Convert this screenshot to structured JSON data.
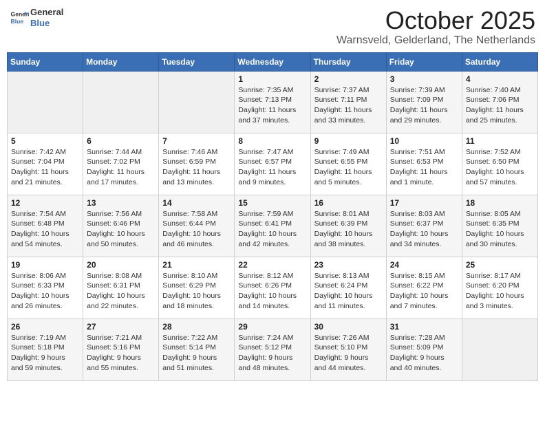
{
  "header": {
    "logo_line1": "General",
    "logo_line2": "Blue",
    "month": "October 2025",
    "location": "Warnsveld, Gelderland, The Netherlands"
  },
  "weekdays": [
    "Sunday",
    "Monday",
    "Tuesday",
    "Wednesday",
    "Thursday",
    "Friday",
    "Saturday"
  ],
  "weeks": [
    [
      {
        "day": "",
        "info": ""
      },
      {
        "day": "",
        "info": ""
      },
      {
        "day": "",
        "info": ""
      },
      {
        "day": "1",
        "info": "Sunrise: 7:35 AM\nSunset: 7:13 PM\nDaylight: 11 hours\nand 37 minutes."
      },
      {
        "day": "2",
        "info": "Sunrise: 7:37 AM\nSunset: 7:11 PM\nDaylight: 11 hours\nand 33 minutes."
      },
      {
        "day": "3",
        "info": "Sunrise: 7:39 AM\nSunset: 7:09 PM\nDaylight: 11 hours\nand 29 minutes."
      },
      {
        "day": "4",
        "info": "Sunrise: 7:40 AM\nSunset: 7:06 PM\nDaylight: 11 hours\nand 25 minutes."
      }
    ],
    [
      {
        "day": "5",
        "info": "Sunrise: 7:42 AM\nSunset: 7:04 PM\nDaylight: 11 hours\nand 21 minutes."
      },
      {
        "day": "6",
        "info": "Sunrise: 7:44 AM\nSunset: 7:02 PM\nDaylight: 11 hours\nand 17 minutes."
      },
      {
        "day": "7",
        "info": "Sunrise: 7:46 AM\nSunset: 6:59 PM\nDaylight: 11 hours\nand 13 minutes."
      },
      {
        "day": "8",
        "info": "Sunrise: 7:47 AM\nSunset: 6:57 PM\nDaylight: 11 hours\nand 9 minutes."
      },
      {
        "day": "9",
        "info": "Sunrise: 7:49 AM\nSunset: 6:55 PM\nDaylight: 11 hours\nand 5 minutes."
      },
      {
        "day": "10",
        "info": "Sunrise: 7:51 AM\nSunset: 6:53 PM\nDaylight: 11 hours\nand 1 minute."
      },
      {
        "day": "11",
        "info": "Sunrise: 7:52 AM\nSunset: 6:50 PM\nDaylight: 10 hours\nand 57 minutes."
      }
    ],
    [
      {
        "day": "12",
        "info": "Sunrise: 7:54 AM\nSunset: 6:48 PM\nDaylight: 10 hours\nand 54 minutes."
      },
      {
        "day": "13",
        "info": "Sunrise: 7:56 AM\nSunset: 6:46 PM\nDaylight: 10 hours\nand 50 minutes."
      },
      {
        "day": "14",
        "info": "Sunrise: 7:58 AM\nSunset: 6:44 PM\nDaylight: 10 hours\nand 46 minutes."
      },
      {
        "day": "15",
        "info": "Sunrise: 7:59 AM\nSunset: 6:41 PM\nDaylight: 10 hours\nand 42 minutes."
      },
      {
        "day": "16",
        "info": "Sunrise: 8:01 AM\nSunset: 6:39 PM\nDaylight: 10 hours\nand 38 minutes."
      },
      {
        "day": "17",
        "info": "Sunrise: 8:03 AM\nSunset: 6:37 PM\nDaylight: 10 hours\nand 34 minutes."
      },
      {
        "day": "18",
        "info": "Sunrise: 8:05 AM\nSunset: 6:35 PM\nDaylight: 10 hours\nand 30 minutes."
      }
    ],
    [
      {
        "day": "19",
        "info": "Sunrise: 8:06 AM\nSunset: 6:33 PM\nDaylight: 10 hours\nand 26 minutes."
      },
      {
        "day": "20",
        "info": "Sunrise: 8:08 AM\nSunset: 6:31 PM\nDaylight: 10 hours\nand 22 minutes."
      },
      {
        "day": "21",
        "info": "Sunrise: 8:10 AM\nSunset: 6:29 PM\nDaylight: 10 hours\nand 18 minutes."
      },
      {
        "day": "22",
        "info": "Sunrise: 8:12 AM\nSunset: 6:26 PM\nDaylight: 10 hours\nand 14 minutes."
      },
      {
        "day": "23",
        "info": "Sunrise: 8:13 AM\nSunset: 6:24 PM\nDaylight: 10 hours\nand 11 minutes."
      },
      {
        "day": "24",
        "info": "Sunrise: 8:15 AM\nSunset: 6:22 PM\nDaylight: 10 hours\nand 7 minutes."
      },
      {
        "day": "25",
        "info": "Sunrise: 8:17 AM\nSunset: 6:20 PM\nDaylight: 10 hours\nand 3 minutes."
      }
    ],
    [
      {
        "day": "26",
        "info": "Sunrise: 7:19 AM\nSunset: 5:18 PM\nDaylight: 9 hours\nand 59 minutes."
      },
      {
        "day": "27",
        "info": "Sunrise: 7:21 AM\nSunset: 5:16 PM\nDaylight: 9 hours\nand 55 minutes."
      },
      {
        "day": "28",
        "info": "Sunrise: 7:22 AM\nSunset: 5:14 PM\nDaylight: 9 hours\nand 51 minutes."
      },
      {
        "day": "29",
        "info": "Sunrise: 7:24 AM\nSunset: 5:12 PM\nDaylight: 9 hours\nand 48 minutes."
      },
      {
        "day": "30",
        "info": "Sunrise: 7:26 AM\nSunset: 5:10 PM\nDaylight: 9 hours\nand 44 minutes."
      },
      {
        "day": "31",
        "info": "Sunrise: 7:28 AM\nSunset: 5:09 PM\nDaylight: 9 hours\nand 40 minutes."
      },
      {
        "day": "",
        "info": ""
      }
    ]
  ]
}
